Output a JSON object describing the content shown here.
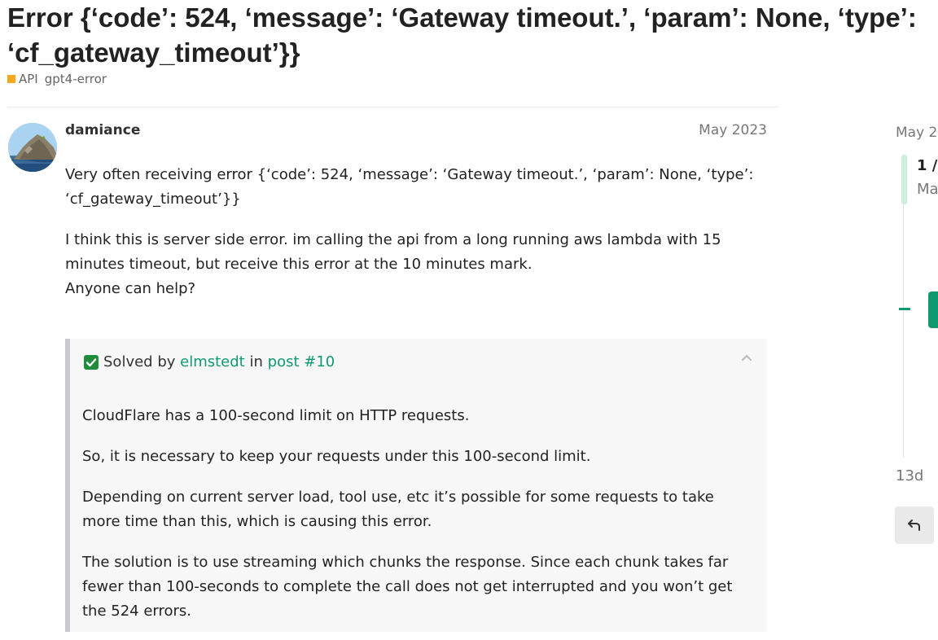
{
  "topic": {
    "title": "Error {‘code’: 524, ‘message’: ‘Gateway timeout.’, ‘param’: None, ‘type’: ‘cf_gateway_timeout’}}",
    "category": "API",
    "tag": "gpt4-error"
  },
  "post": {
    "username": "damiance",
    "date": "May 2023",
    "paragraphs": [
      "Very often receiving error {‘code’: 524, ‘message’: ‘Gateway timeout.’, ‘param’: None, ‘type’: ‘cf_gateway_timeout’}}",
      "I think this is server side error. im calling the api from a long running aws lambda with 15 minutes timeout, but receive this error at the 10 minutes mark.",
      "Anyone can help?"
    ]
  },
  "solved": {
    "prefix": "Solved by",
    "user": "elmstedt",
    "mid": "in",
    "post_link": "post #10",
    "paragraphs": [
      "CloudFlare has a 100-second limit on HTTP requests.",
      "So, it is necessary to keep your requests under this 100-second limit.",
      "Depending on current server load, tool use, etc it’s possible for some requests to take more time than this, which is causing this error.",
      "The solution is to use streaming which chunks the response. Since each chunk takes far fewer than 100-seconds to complete the call does not get interrupted and you won’t get the 524 errors."
    ]
  },
  "timeline": {
    "top_date": "May 2",
    "position": "1 /",
    "position_sub": "Ma",
    "bottom_date": "13d"
  },
  "icons": {
    "check": "checkbox-check-icon",
    "collapse": "chevron-up-icon",
    "reply": "reply-icon"
  },
  "colors": {
    "link_green": "#109970",
    "category": "#f7a81b",
    "solved_border": "#c8c8d0"
  }
}
